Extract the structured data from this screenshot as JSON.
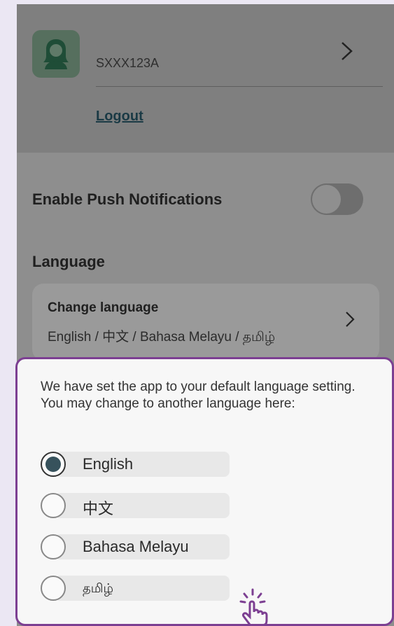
{
  "profile": {
    "user_id": "SXXX123A",
    "logout_label": "Logout"
  },
  "settings": {
    "push_label": "Enable Push Notifications",
    "push_enabled": false,
    "language_heading": "Language",
    "change_language_title": "Change language",
    "change_language_subtitle": "English / 中文 / Bahasa Melayu / தமிழ்"
  },
  "language_sheet": {
    "message": "We have set the app to your default language setting. You may change to another language here:",
    "options": [
      {
        "label": "English",
        "selected": true
      },
      {
        "label": "中文",
        "selected": false
      },
      {
        "label": "Bahasa Melayu",
        "selected": false
      },
      {
        "label": "தமிழ்",
        "selected": false
      }
    ]
  },
  "colors": {
    "sheet_border": "#7c3f92",
    "radio_selected": "#37525c",
    "avatar_bg": "#566f5e"
  },
  "icons": {
    "avatar": "user-avatar-icon",
    "chevron": "chevron-right-icon",
    "tap": "tap-hand-icon"
  }
}
